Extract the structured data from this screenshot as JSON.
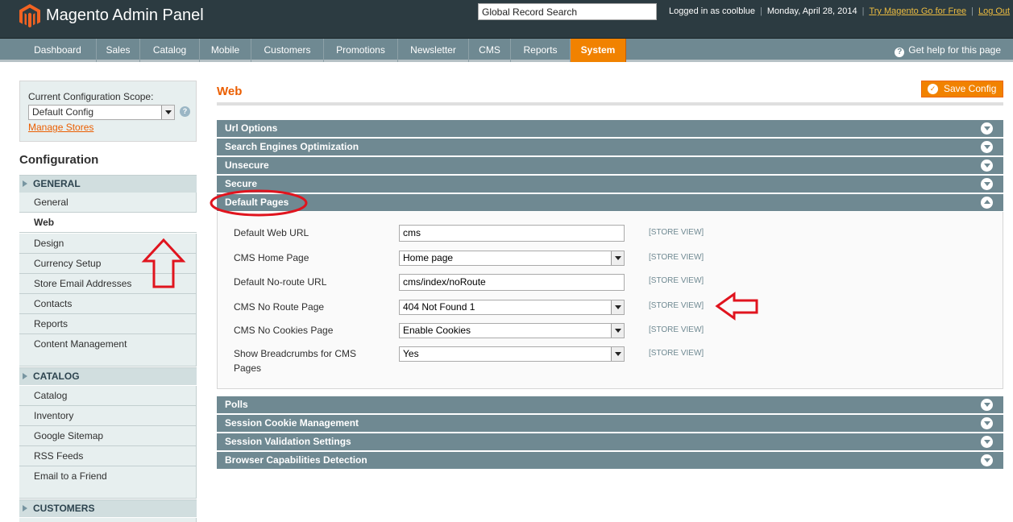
{
  "header": {
    "logo_text": "Magento Admin Panel",
    "search_value": "Global Record Search",
    "logged_in": "Logged in as coolblue",
    "date": "Monday, April 28, 2014",
    "try_link": "Try Magento Go for Free",
    "logout": "Log Out"
  },
  "nav": {
    "items": [
      "Dashboard",
      "Sales",
      "Catalog",
      "Mobile",
      "Customers",
      "Promotions",
      "Newsletter",
      "CMS",
      "Reports",
      "System"
    ],
    "active": "System",
    "help": "Get help for this page"
  },
  "scope": {
    "label": "Current Configuration Scope:",
    "value": "Default Config",
    "manage_stores": "Manage Stores"
  },
  "sidebar": {
    "title": "Configuration",
    "sections": [
      {
        "label": "GENERAL",
        "items": [
          "General",
          "Web",
          "Design",
          "Currency Setup",
          "Store Email Addresses",
          "Contacts",
          "Reports",
          "Content Management"
        ]
      },
      {
        "label": "CATALOG",
        "items": [
          "Catalog",
          "Inventory",
          "Google Sitemap",
          "RSS Feeds",
          "Email to a Friend"
        ]
      },
      {
        "label": "CUSTOMERS",
        "items": []
      }
    ],
    "active_item": "Web"
  },
  "main": {
    "title": "Web",
    "save_button": "Save Config",
    "sections_top": [
      "Url Options",
      "Search Engines Optimization",
      "Unsecure",
      "Secure",
      "Default Pages"
    ],
    "sections_bottom": [
      "Polls",
      "Session Cookie Management",
      "Session Validation Settings",
      "Browser Capabilities Detection"
    ],
    "fields": [
      {
        "label": "Default Web URL",
        "value": "cms",
        "type": "input",
        "scope": "[STORE VIEW]"
      },
      {
        "label": "CMS Home Page",
        "value": "Home page",
        "type": "select",
        "scope": "[STORE VIEW]"
      },
      {
        "label": "Default No-route URL",
        "value": "cms/index/noRoute",
        "type": "input",
        "scope": "[STORE VIEW]"
      },
      {
        "label": "CMS No Route Page",
        "value": "404 Not Found 1",
        "type": "select",
        "scope": "[STORE VIEW]"
      },
      {
        "label": "CMS No Cookies Page",
        "value": "Enable Cookies",
        "type": "select",
        "scope": "[STORE VIEW]"
      },
      {
        "label": "Show Breadcrumbs for CMS Pages",
        "value": "Yes",
        "type": "select",
        "scope": "[STORE VIEW]"
      }
    ]
  },
  "colors": {
    "header_bg": "#2c3b41",
    "nav_bg": "#6f8992",
    "accent": "#f18200",
    "title_orange": "#eb5e00",
    "annotation_red": "#e0141e"
  }
}
